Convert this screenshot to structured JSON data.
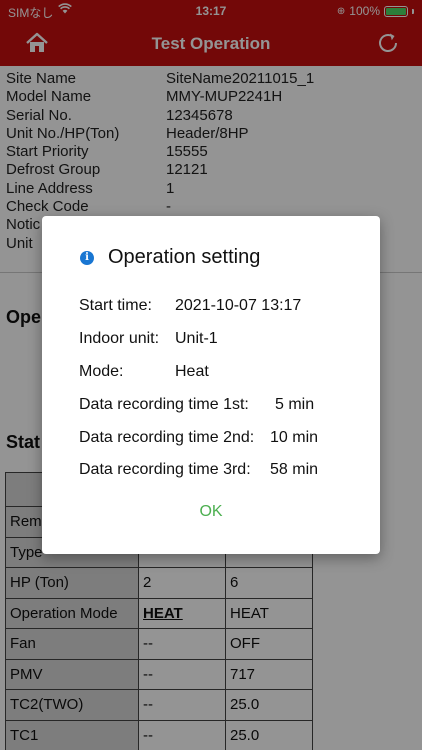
{
  "status_bar": {
    "carrier": "SIMなし",
    "time": "13:17",
    "battery": "100%"
  },
  "header": {
    "title": "Test Operation",
    "icons": [
      "home-icon",
      "refresh-icon"
    ],
    "color": "#c70f0f"
  },
  "info": [
    {
      "label": "Site Name",
      "value": "SiteName20211015_1"
    },
    {
      "label": "Model Name",
      "value": "MMY-MUP2241H"
    },
    {
      "label": "Serial No.",
      "value": "12345678"
    },
    {
      "label": "Unit No./HP(Ton)",
      "value": "Header/8HP"
    },
    {
      "label": "Start Priority",
      "value": "15555"
    },
    {
      "label": "Defrost Group",
      "value": "12121"
    },
    {
      "label": "Line Address",
      "value": "1"
    },
    {
      "label": "Check Code",
      "value": "-"
    },
    {
      "label": "Notic",
      "value": ""
    },
    {
      "label": "Unit",
      "value": ""
    }
  ],
  "sections": {
    "operation": "Ope",
    "status": "Stat"
  },
  "table": {
    "rows": [
      {
        "label": "",
        "c1": "",
        "c2": ""
      },
      {
        "label": "Remo",
        "c1": "",
        "c2": ""
      },
      {
        "label": "Type",
        "c1": "",
        "c2": ""
      },
      {
        "label": "HP (Ton)",
        "c1": "2",
        "c2": "6"
      },
      {
        "label": "Operation Mode",
        "c1": "HEAT",
        "c2": "HEAT"
      },
      {
        "label": "Fan",
        "c1": "--",
        "c2": "OFF"
      },
      {
        "label": "PMV",
        "c1": "--",
        "c2": "717"
      },
      {
        "label": "TC2(TWO)",
        "c1": "--",
        "c2": "25.0"
      },
      {
        "label": "TC1",
        "c1": "--",
        "c2": "25.0"
      }
    ]
  },
  "dialog": {
    "title": "Operation setting",
    "icon": "info-icon",
    "start_time_label": "Start time:",
    "start_time_value": "2021-10-07 13:17",
    "indoor_unit_label": "Indoor unit:",
    "indoor_unit_value": "Unit-1",
    "mode_label": "Mode:",
    "mode_value": "Heat",
    "rec1_label": "Data recording time 1st:",
    "rec1_value": "5 min",
    "rec2_label": "Data recording time 2nd:",
    "rec2_value": "10 min",
    "rec3_label": "Data recording time 3rd:",
    "rec3_value": "58 min",
    "ok_label": "OK",
    "ok_color": "#4caf50"
  }
}
